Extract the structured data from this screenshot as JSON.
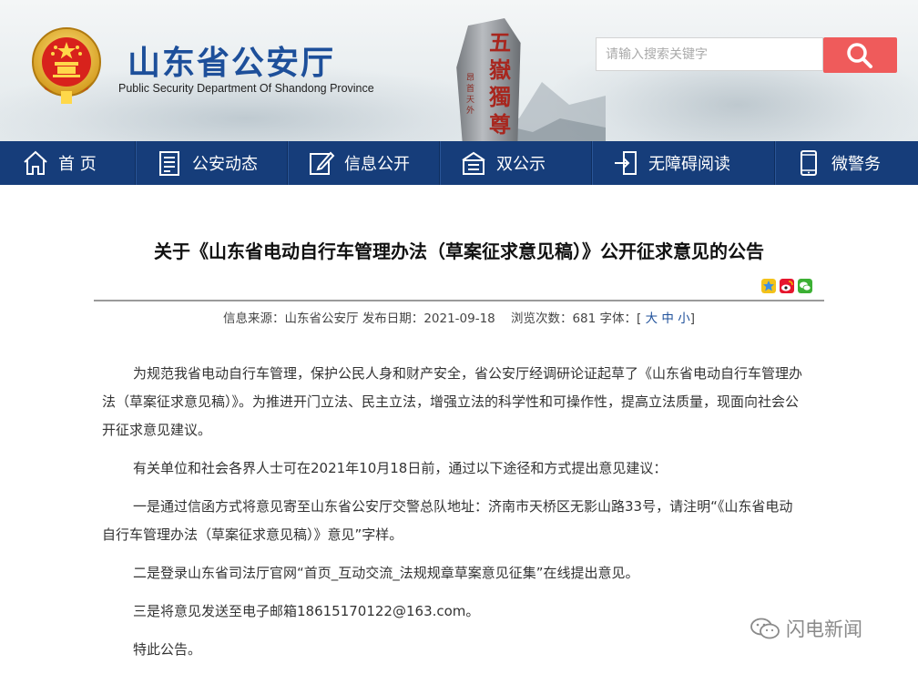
{
  "header": {
    "title": "山东省公安厅",
    "subtitle": "Public Security Department Of Shandong Province",
    "stone_text": "五嶽獨尊",
    "stone_small_text": "昂首天外"
  },
  "search": {
    "placeholder": "请输入搜索关键字"
  },
  "nav": {
    "items": [
      {
        "label": "首 页",
        "icon": "home-icon"
      },
      {
        "label": "公安动态",
        "icon": "news-icon"
      },
      {
        "label": "信息公开",
        "icon": "edit-icon"
      },
      {
        "label": "双公示",
        "icon": "inbox-icon"
      },
      {
        "label": "无障碍阅读",
        "icon": "accessibility-icon"
      },
      {
        "label": "微警务",
        "icon": "mobile-icon"
      }
    ]
  },
  "article": {
    "title": "关于《山东省电动自行车管理办法（草案征求意见稿）》公开征求意见的公告",
    "meta": {
      "source_label": "信息来源：",
      "source": "山东省公安厅",
      "date_label": "发布日期：",
      "date": "2021-09-18",
      "views_label": "浏览次数：",
      "views": "681",
      "font_label": "字体：",
      "font_open": "[",
      "font_large": "大",
      "font_medium": "中",
      "font_small": "小",
      "font_close": "]"
    },
    "paragraphs": [
      "为规范我省电动自行车管理，保护公民人身和财产安全，省公安厅经调研论证起草了《山东省电动自行车管理办法（草案征求意见稿）》。为推进开门立法、民主立法，增强立法的科学性和可操作性，提高立法质量，现面向社会公开征求意见建议。",
      "有关单位和社会各界人士可在2021年10月18日前，通过以下途径和方式提出意见建议：",
      "一是通过信函方式将意见寄至山东省公安厅交警总队地址：济南市天桥区无影山路33号，请注明“《山东省电动自行车管理办法（草案征求意见稿）》意见”字样。",
      "二是登录山东省司法厅官网“首页_互动交流_法规规章草案意见征集”在线提出意见。",
      "三是将意见发送至电子邮箱18615170122@163.com。",
      "特此公告。"
    ]
  },
  "watermark": {
    "text": "闪电新闻"
  },
  "colors": {
    "nav_bg": "#163d7a",
    "title_blue": "#1d4f9a",
    "search_button": "#ef5b5b"
  }
}
